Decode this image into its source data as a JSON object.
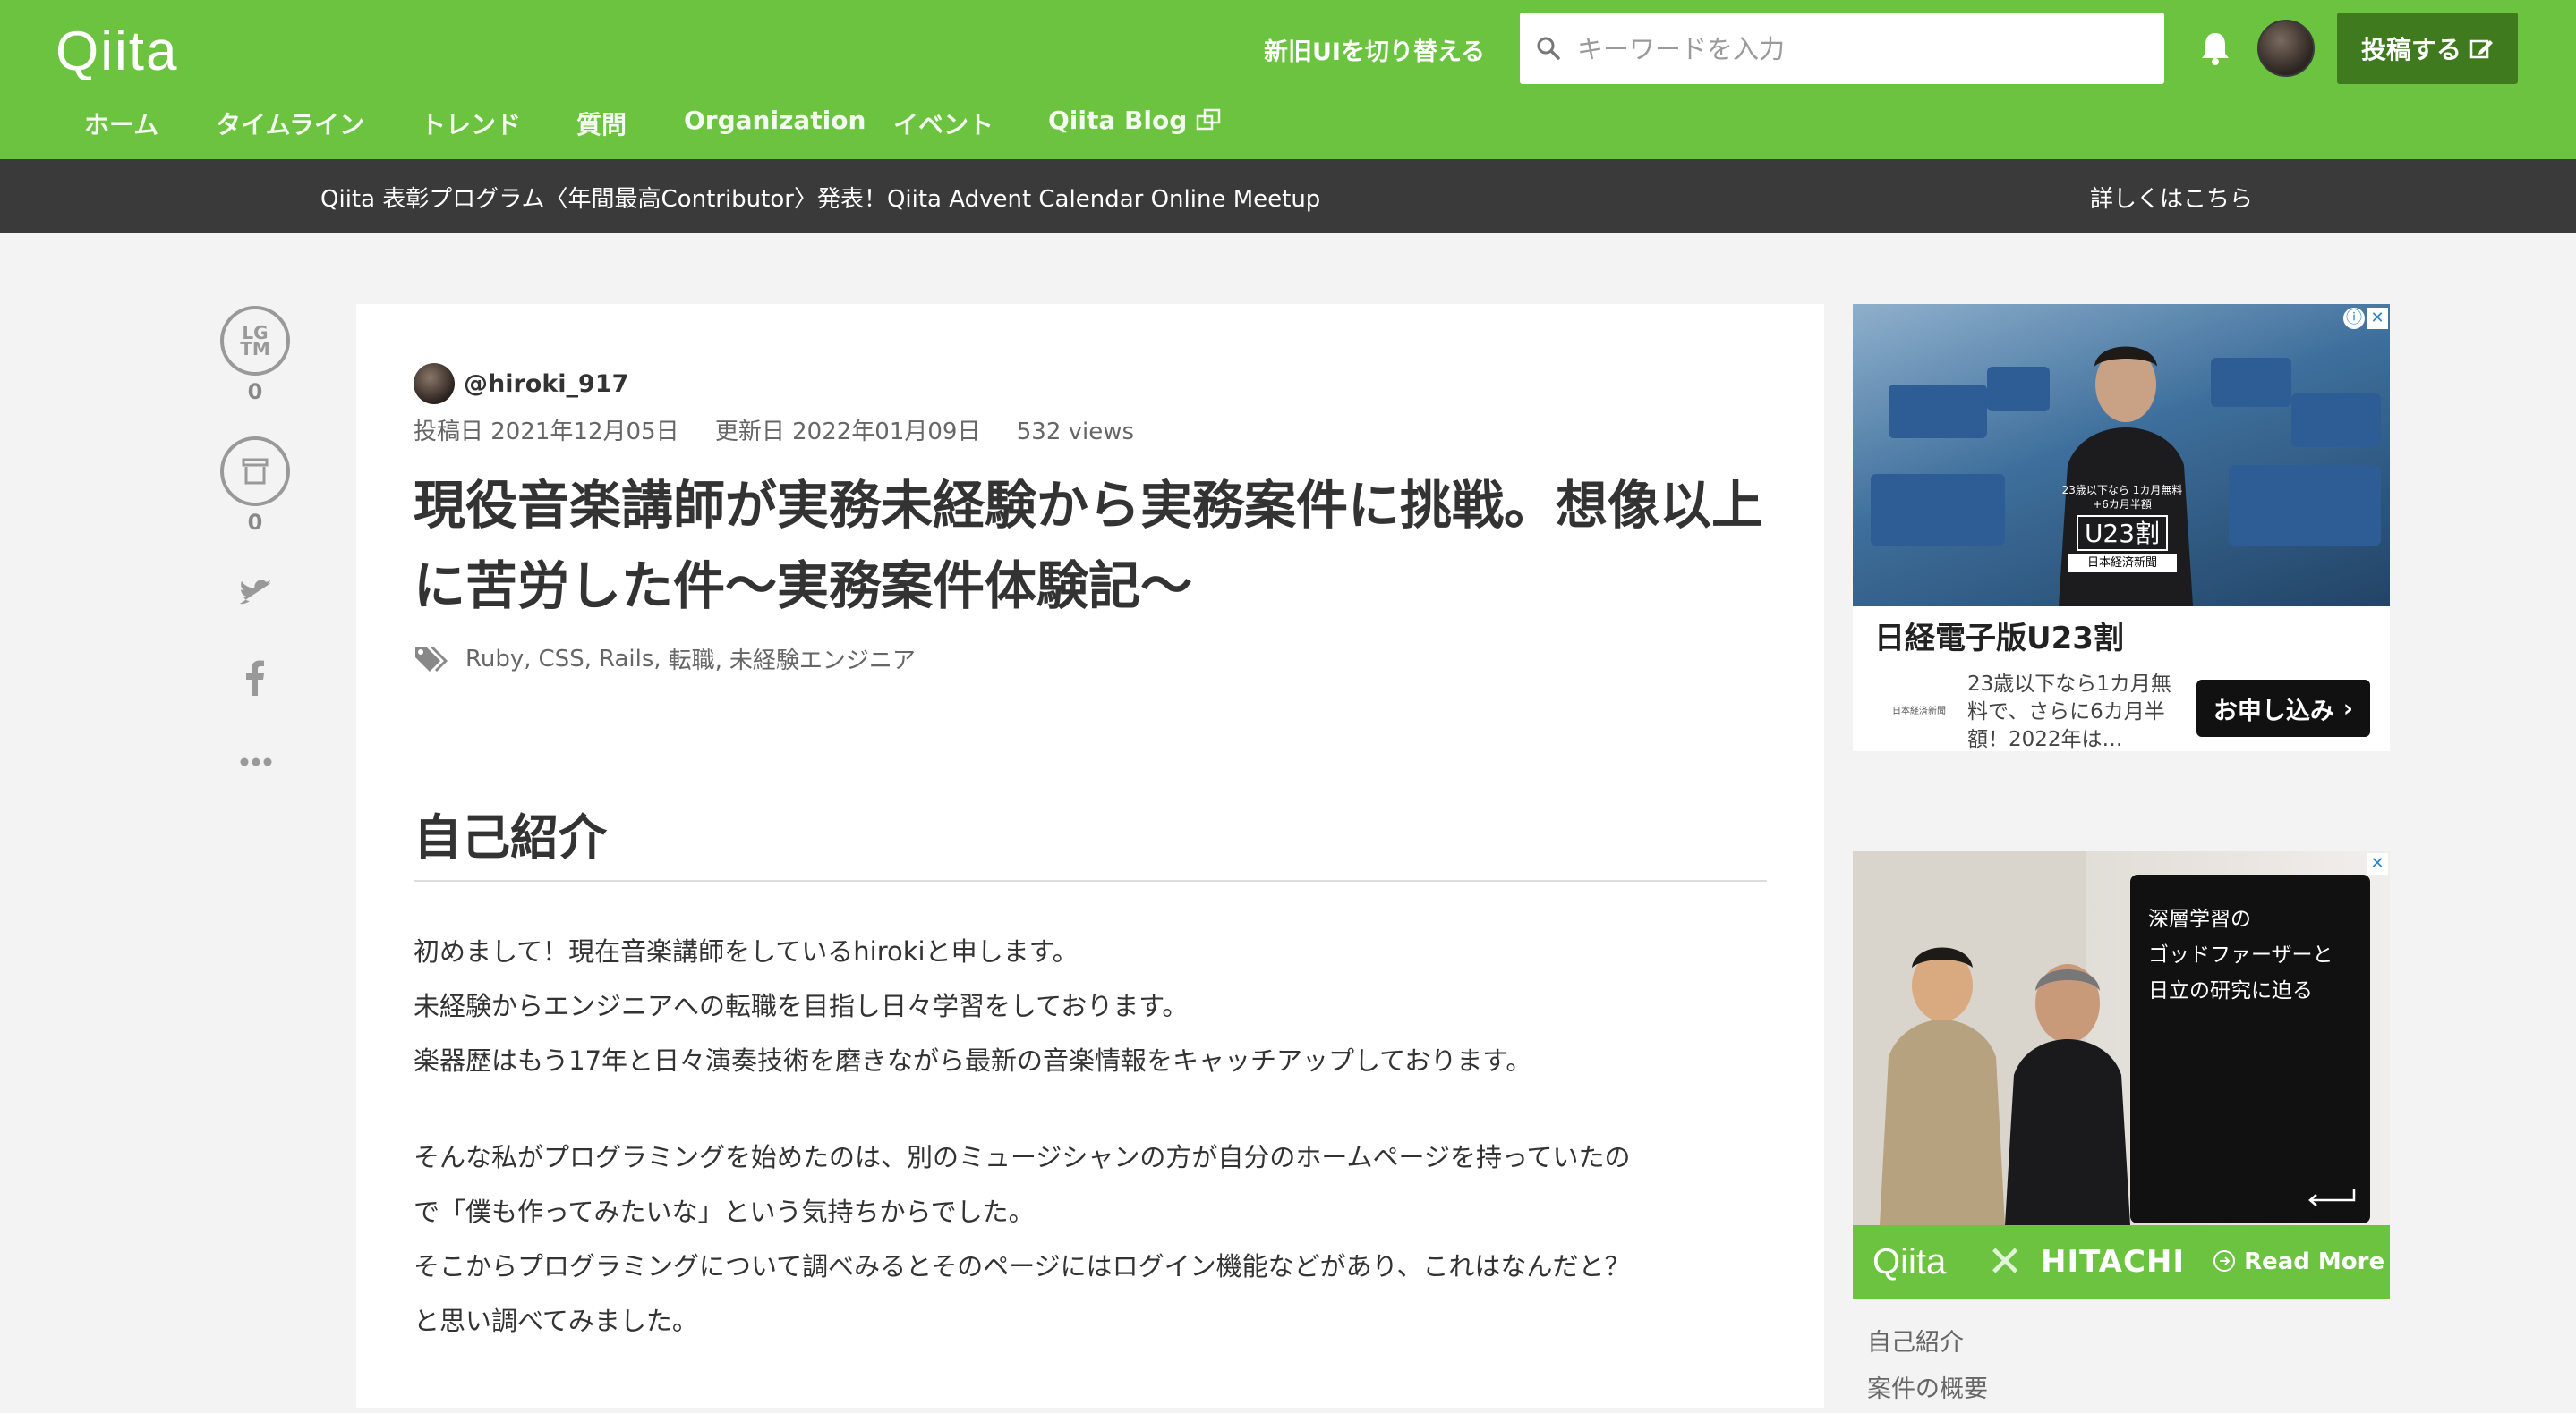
{
  "header": {
    "logo": "Qiita",
    "switch_ui": "新旧UIを切り替える",
    "search_placeholder": "キーワードを入力",
    "post_button": "投稿する",
    "nav": [
      "ホーム",
      "タイムライン",
      "トレンド",
      "質問",
      "Organization",
      "イベント",
      "Qiita Blog"
    ],
    "brand_color": "#6bc33f"
  },
  "banner": {
    "message": "Qiita 表彰プログラム〈年間最高Contributor〉発表！Qiita Advent Calendar Online Meetup",
    "link": "詳しくはこちら"
  },
  "actions": {
    "lgtm_label": "LG TM",
    "lgtm_count": "0",
    "stock_count": "0"
  },
  "article": {
    "author": "@hiroki_917",
    "posted": "投稿日 2021年12月05日",
    "updated": "更新日 2022年01月09日",
    "views": "532 views",
    "title": "現役音楽講師が実務未経験から実務案件に挑戦。想像以上に苦労した件〜実務案件体験記〜",
    "tags": [
      "Ruby,",
      "CSS,",
      "Rails,",
      "転職,",
      "未経験エンジニア"
    ],
    "section_heading": "自己紹介",
    "paragraph1": [
      "初めまして！現在音楽講師をしているhirokiと申します。",
      "未経験からエンジニアへの転職を目指し日々学習をしております。",
      "楽器歴はもう17年と日々演奏技術を磨きながら最新の音楽情報をキャッチアップしております。"
    ],
    "paragraph2": [
      "そんな私がプログラミングを始めたのは、別のミュージシャンの方が自分のホームページを持っていたの",
      "で「僕も作ってみたいな」という気持ちからでした。",
      "そこからプログラミングについて調べみるとそのページにはログイン機能などがあり、これはなんだと？",
      "と思い調べてみました。"
    ]
  },
  "ad1": {
    "u23_small": "23歳以下なら 1カ月無料+6カ月半額",
    "u23_badge": "U23割",
    "nikkei": "日本経済新聞",
    "headline": "日経電子版U23割",
    "description": "23歳以下なら1カ月無料で、さらに6カ月半額！2022年は…",
    "cta": "お申し込み"
  },
  "ad2": {
    "overlay_text": [
      "深層学習の",
      "ゴッドファーザーと",
      "日立の研究に迫る"
    ],
    "qiita": "Qiita",
    "hitachi": "HITACHI",
    "read_more": "Read More"
  },
  "toc": [
    "自己紹介",
    "案件の概要"
  ]
}
